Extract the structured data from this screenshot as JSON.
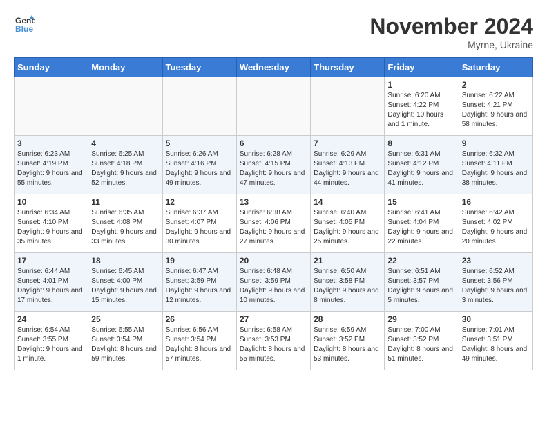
{
  "header": {
    "logo_line1": "General",
    "logo_line2": "Blue",
    "month": "November 2024",
    "location": "Myrne, Ukraine"
  },
  "weekdays": [
    "Sunday",
    "Monday",
    "Tuesday",
    "Wednesday",
    "Thursday",
    "Friday",
    "Saturday"
  ],
  "weeks": [
    [
      {
        "day": "",
        "info": ""
      },
      {
        "day": "",
        "info": ""
      },
      {
        "day": "",
        "info": ""
      },
      {
        "day": "",
        "info": ""
      },
      {
        "day": "",
        "info": ""
      },
      {
        "day": "1",
        "info": "Sunrise: 6:20 AM\nSunset: 4:22 PM\nDaylight: 10 hours and 1 minute."
      },
      {
        "day": "2",
        "info": "Sunrise: 6:22 AM\nSunset: 4:21 PM\nDaylight: 9 hours and 58 minutes."
      }
    ],
    [
      {
        "day": "3",
        "info": "Sunrise: 6:23 AM\nSunset: 4:19 PM\nDaylight: 9 hours and 55 minutes."
      },
      {
        "day": "4",
        "info": "Sunrise: 6:25 AM\nSunset: 4:18 PM\nDaylight: 9 hours and 52 minutes."
      },
      {
        "day": "5",
        "info": "Sunrise: 6:26 AM\nSunset: 4:16 PM\nDaylight: 9 hours and 49 minutes."
      },
      {
        "day": "6",
        "info": "Sunrise: 6:28 AM\nSunset: 4:15 PM\nDaylight: 9 hours and 47 minutes."
      },
      {
        "day": "7",
        "info": "Sunrise: 6:29 AM\nSunset: 4:13 PM\nDaylight: 9 hours and 44 minutes."
      },
      {
        "day": "8",
        "info": "Sunrise: 6:31 AM\nSunset: 4:12 PM\nDaylight: 9 hours and 41 minutes."
      },
      {
        "day": "9",
        "info": "Sunrise: 6:32 AM\nSunset: 4:11 PM\nDaylight: 9 hours and 38 minutes."
      }
    ],
    [
      {
        "day": "10",
        "info": "Sunrise: 6:34 AM\nSunset: 4:10 PM\nDaylight: 9 hours and 35 minutes."
      },
      {
        "day": "11",
        "info": "Sunrise: 6:35 AM\nSunset: 4:08 PM\nDaylight: 9 hours and 33 minutes."
      },
      {
        "day": "12",
        "info": "Sunrise: 6:37 AM\nSunset: 4:07 PM\nDaylight: 9 hours and 30 minutes."
      },
      {
        "day": "13",
        "info": "Sunrise: 6:38 AM\nSunset: 4:06 PM\nDaylight: 9 hours and 27 minutes."
      },
      {
        "day": "14",
        "info": "Sunrise: 6:40 AM\nSunset: 4:05 PM\nDaylight: 9 hours and 25 minutes."
      },
      {
        "day": "15",
        "info": "Sunrise: 6:41 AM\nSunset: 4:04 PM\nDaylight: 9 hours and 22 minutes."
      },
      {
        "day": "16",
        "info": "Sunrise: 6:42 AM\nSunset: 4:02 PM\nDaylight: 9 hours and 20 minutes."
      }
    ],
    [
      {
        "day": "17",
        "info": "Sunrise: 6:44 AM\nSunset: 4:01 PM\nDaylight: 9 hours and 17 minutes."
      },
      {
        "day": "18",
        "info": "Sunrise: 6:45 AM\nSunset: 4:00 PM\nDaylight: 9 hours and 15 minutes."
      },
      {
        "day": "19",
        "info": "Sunrise: 6:47 AM\nSunset: 3:59 PM\nDaylight: 9 hours and 12 minutes."
      },
      {
        "day": "20",
        "info": "Sunrise: 6:48 AM\nSunset: 3:59 PM\nDaylight: 9 hours and 10 minutes."
      },
      {
        "day": "21",
        "info": "Sunrise: 6:50 AM\nSunset: 3:58 PM\nDaylight: 9 hours and 8 minutes."
      },
      {
        "day": "22",
        "info": "Sunrise: 6:51 AM\nSunset: 3:57 PM\nDaylight: 9 hours and 5 minutes."
      },
      {
        "day": "23",
        "info": "Sunrise: 6:52 AM\nSunset: 3:56 PM\nDaylight: 9 hours and 3 minutes."
      }
    ],
    [
      {
        "day": "24",
        "info": "Sunrise: 6:54 AM\nSunset: 3:55 PM\nDaylight: 9 hours and 1 minute."
      },
      {
        "day": "25",
        "info": "Sunrise: 6:55 AM\nSunset: 3:54 PM\nDaylight: 8 hours and 59 minutes."
      },
      {
        "day": "26",
        "info": "Sunrise: 6:56 AM\nSunset: 3:54 PM\nDaylight: 8 hours and 57 minutes."
      },
      {
        "day": "27",
        "info": "Sunrise: 6:58 AM\nSunset: 3:53 PM\nDaylight: 8 hours and 55 minutes."
      },
      {
        "day": "28",
        "info": "Sunrise: 6:59 AM\nSunset: 3:52 PM\nDaylight: 8 hours and 53 minutes."
      },
      {
        "day": "29",
        "info": "Sunrise: 7:00 AM\nSunset: 3:52 PM\nDaylight: 8 hours and 51 minutes."
      },
      {
        "day": "30",
        "info": "Sunrise: 7:01 AM\nSunset: 3:51 PM\nDaylight: 8 hours and 49 minutes."
      }
    ]
  ]
}
